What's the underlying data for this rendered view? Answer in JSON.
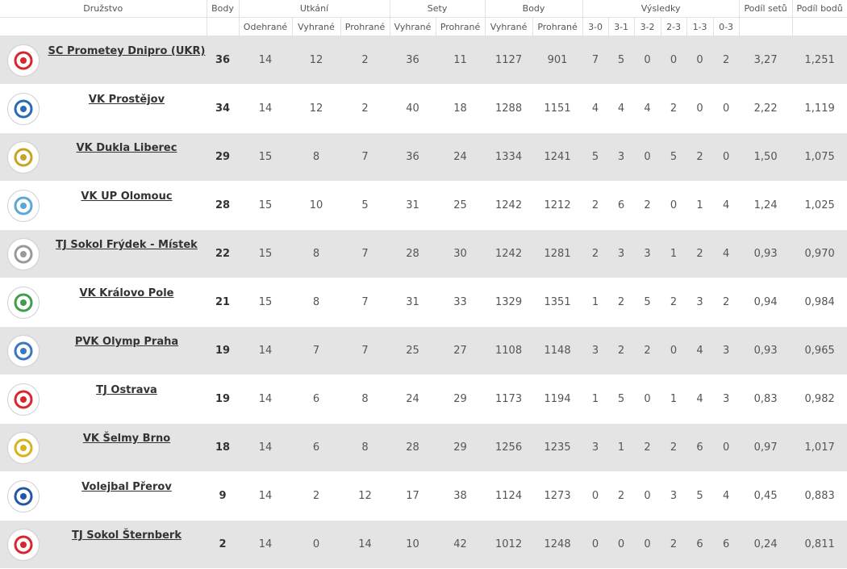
{
  "headers": {
    "team": "Družstvo",
    "points": "Body",
    "matches": "Utkání",
    "sets": "Sety",
    "ballpoints": "Body",
    "results": "Výsledky",
    "set_ratio": "Podíl setů",
    "point_ratio": "Podíl bodů",
    "played": "Odehrané",
    "won": "Vyhrané",
    "lost": "Prohrané",
    "sets_won": "Vyhrané",
    "sets_lost": "Prohrané",
    "bp_won": "Vyhrané",
    "bp_lost": "Prohrané",
    "r30": "3-0",
    "r31": "3-1",
    "r32": "3-2",
    "r23": "2-3",
    "r13": "1-3",
    "r03": "0-3"
  },
  "rows": [
    {
      "team": "SC Prometey Dnipro (UKR)",
      "points": "36",
      "played": "14",
      "won": "12",
      "lost": "2",
      "sw": "36",
      "sl": "11",
      "bw": "1127",
      "bl": "901",
      "r30": "7",
      "r31": "5",
      "r32": "0",
      "r23": "0",
      "r13": "0",
      "r03": "2",
      "sr": "3,27",
      "pr": "1,251",
      "logo": "prometey-logo",
      "color": "#d8262e"
    },
    {
      "team": "VK Prostějov",
      "points": "34",
      "played": "14",
      "won": "12",
      "lost": "2",
      "sw": "40",
      "sl": "18",
      "bw": "1288",
      "bl": "1151",
      "r30": "4",
      "r31": "4",
      "r32": "4",
      "r23": "2",
      "r13": "0",
      "r03": "0",
      "sr": "2,22",
      "pr": "1,119",
      "logo": "prostejov-logo",
      "color": "#2a6ab5"
    },
    {
      "team": "VK Dukla Liberec",
      "points": "29",
      "played": "15",
      "won": "8",
      "lost": "7",
      "sw": "36",
      "sl": "24",
      "bw": "1334",
      "bl": "1241",
      "r30": "5",
      "r31": "3",
      "r32": "0",
      "r23": "5",
      "r13": "2",
      "r03": "0",
      "sr": "1,50",
      "pr": "1,075",
      "logo": "dukla-logo",
      "color": "#c9a227"
    },
    {
      "team": "VK UP Olomouc",
      "points": "28",
      "played": "15",
      "won": "10",
      "lost": "5",
      "sw": "31",
      "sl": "25",
      "bw": "1242",
      "bl": "1212",
      "r30": "2",
      "r31": "6",
      "r32": "2",
      "r23": "0",
      "r13": "1",
      "r03": "4",
      "sr": "1,24",
      "pr": "1,025",
      "logo": "olomouc-logo",
      "color": "#5aa7d8"
    },
    {
      "team": "TJ Sokol Frýdek - Místek",
      "points": "22",
      "played": "15",
      "won": "8",
      "lost": "7",
      "sw": "28",
      "sl": "30",
      "bw": "1242",
      "bl": "1281",
      "r30": "2",
      "r31": "3",
      "r32": "3",
      "r23": "1",
      "r13": "2",
      "r03": "4",
      "sr": "0,93",
      "pr": "0,970",
      "logo": "frydek-logo",
      "color": "#999999"
    },
    {
      "team": "VK Královo Pole",
      "points": "21",
      "played": "15",
      "won": "8",
      "lost": "7",
      "sw": "31",
      "sl": "33",
      "bw": "1329",
      "bl": "1351",
      "r30": "1",
      "r31": "2",
      "r32": "5",
      "r23": "2",
      "r13": "3",
      "r03": "2",
      "sr": "0,94",
      "pr": "0,984",
      "logo": "kralovo-pole-logo",
      "color": "#3f9e4a"
    },
    {
      "team": "PVK Olymp Praha",
      "points": "19",
      "played": "14",
      "won": "7",
      "lost": "7",
      "sw": "25",
      "sl": "27",
      "bw": "1108",
      "bl": "1148",
      "r30": "3",
      "r31": "2",
      "r32": "2",
      "r23": "0",
      "r13": "4",
      "r03": "3",
      "sr": "0,93",
      "pr": "0,965",
      "logo": "olymp-logo",
      "color": "#3b78c4"
    },
    {
      "team": "TJ Ostrava",
      "points": "19",
      "played": "14",
      "won": "6",
      "lost": "8",
      "sw": "24",
      "sl": "29",
      "bw": "1173",
      "bl": "1194",
      "r30": "1",
      "r31": "5",
      "r32": "0",
      "r23": "1",
      "r13": "4",
      "r03": "3",
      "sr": "0,83",
      "pr": "0,982",
      "logo": "ostrava-logo",
      "color": "#d8262e"
    },
    {
      "team": "VK Šelmy Brno",
      "points": "18",
      "played": "14",
      "won": "6",
      "lost": "8",
      "sw": "28",
      "sl": "29",
      "bw": "1256",
      "bl": "1235",
      "r30": "3",
      "r31": "1",
      "r32": "2",
      "r23": "2",
      "r13": "6",
      "r03": "0",
      "sr": "0,97",
      "pr": "1,017",
      "logo": "selmy-logo",
      "color": "#d9b21e"
    },
    {
      "team": "Volejbal Přerov",
      "points": "9",
      "played": "14",
      "won": "2",
      "lost": "12",
      "sw": "17",
      "sl": "38",
      "bw": "1124",
      "bl": "1273",
      "r30": "0",
      "r31": "2",
      "r32": "0",
      "r23": "3",
      "r13": "5",
      "r03": "4",
      "sr": "0,45",
      "pr": "0,883",
      "logo": "prerov-logo",
      "color": "#2456a8"
    },
    {
      "team": "TJ Sokol Šternberk",
      "points": "2",
      "played": "14",
      "won": "0",
      "lost": "14",
      "sw": "10",
      "sl": "42",
      "bw": "1012",
      "bl": "1248",
      "r30": "0",
      "r31": "0",
      "r32": "0",
      "r23": "2",
      "r13": "6",
      "r03": "6",
      "sr": "0,24",
      "pr": "0,811",
      "logo": "sternberk-logo",
      "color": "#d8262e"
    }
  ]
}
